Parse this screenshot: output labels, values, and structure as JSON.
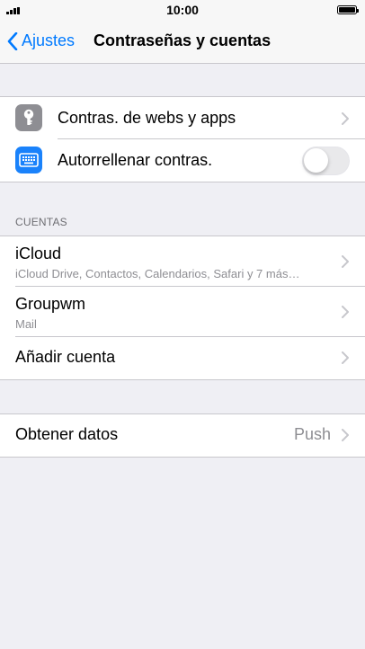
{
  "status_bar": {
    "time": "10:00"
  },
  "nav": {
    "back_label": "Ajustes",
    "title": "Contraseñas y cuentas"
  },
  "passwords_group": {
    "items": [
      {
        "icon": "key-icon",
        "label": "Contras. de webs y apps"
      },
      {
        "icon": "keyboard-icon",
        "label": "Autorrellenar contras.",
        "toggle_on": false
      }
    ]
  },
  "accounts": {
    "header": "CUENTAS",
    "items": [
      {
        "label": "iCloud",
        "sublabel": "iCloud Drive, Contactos, Calendarios, Safari y 7 más…"
      },
      {
        "label": "Groupwm",
        "sublabel": "Mail"
      },
      {
        "label": "Añadir cuenta"
      }
    ]
  },
  "fetch": {
    "label": "Obtener datos",
    "value": "Push"
  },
  "colors": {
    "accent": "#007aff",
    "key_icon_bg": "#8e8e93",
    "keyboard_icon_bg": "#1a82fb",
    "background": "#efeff4"
  }
}
